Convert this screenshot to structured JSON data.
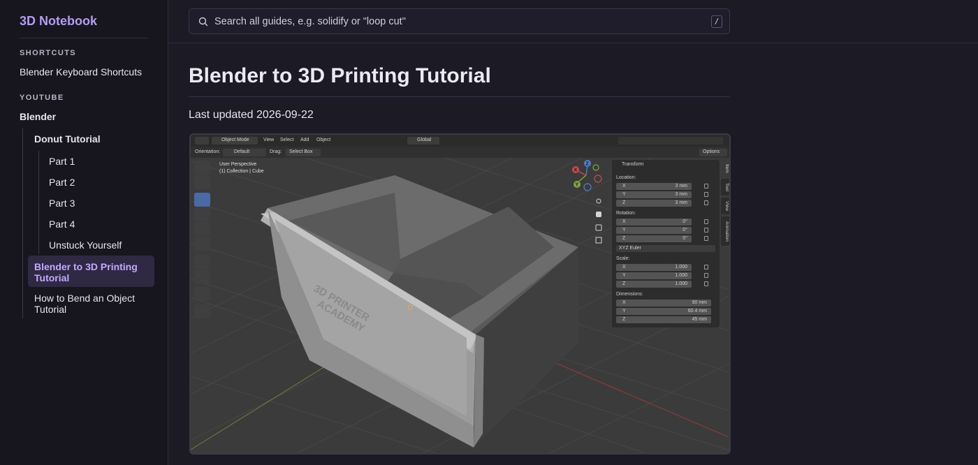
{
  "sidebar": {
    "brand": "3D Notebook",
    "sections": [
      {
        "heading": "SHORTCUTS",
        "items": [
          {
            "label": "Blender Keyboard Shortcuts"
          }
        ]
      },
      {
        "heading": "YOUTUBE"
      }
    ],
    "blender": {
      "label": "Blender",
      "donut": {
        "label": "Donut Tutorial",
        "parts": [
          "Part 1",
          "Part 2",
          "Part 3",
          "Part 4",
          "Unstuck Yourself"
        ]
      },
      "active": "Blender to 3D Printing Tutorial",
      "bend": "How to Bend an Object Tutorial"
    }
  },
  "search": {
    "placeholder": "Search all guides, e.g. solidify or \"loop cut\"",
    "shortcut": "/"
  },
  "article": {
    "title": "Blender to 3D Printing Tutorial",
    "updated": "Last updated 2026-09-22"
  },
  "screenshot": {
    "header": {
      "mode": "Object Mode",
      "menus": [
        "View",
        "Select",
        "Add",
        "Object"
      ],
      "orientation_global": "Global"
    },
    "tool_settings": {
      "orientation_label": "Orientation:",
      "orientation_value": "Default",
      "drag_label": "Drag:",
      "drag_value": "Select Box",
      "options": "Options"
    },
    "viewport": {
      "perspective": "User Perspective",
      "collection": "(1) Collection | Cube",
      "model_text": [
        "3D PRINTER",
        "ACADEMY"
      ],
      "gizmo_axes": [
        "X",
        "Y",
        "Z"
      ]
    },
    "transform_panel": {
      "title": "Transform",
      "location_label": "Location:",
      "location": [
        {
          "axis": "X",
          "value": "3 mm"
        },
        {
          "axis": "Y",
          "value": "3 mm"
        },
        {
          "axis": "Z",
          "value": "3 mm"
        }
      ],
      "rotation_label": "Rotation:",
      "rotation": [
        {
          "axis": "X",
          "value": "0°"
        },
        {
          "axis": "Y",
          "value": "0°"
        },
        {
          "axis": "Z",
          "value": "0°"
        }
      ],
      "rotation_mode": "XYZ Euler",
      "scale_label": "Scale:",
      "scale": [
        {
          "axis": "X",
          "value": "1.000"
        },
        {
          "axis": "Y",
          "value": "1.000"
        },
        {
          "axis": "Z",
          "value": "1.000"
        }
      ],
      "dimensions_label": "Dimensions:",
      "dimensions": [
        {
          "axis": "X",
          "value": "90 mm"
        },
        {
          "axis": "Y",
          "value": "60.4 mm"
        },
        {
          "axis": "Z",
          "value": "45 mm"
        }
      ]
    },
    "side_tabs": [
      "Item",
      "Tool",
      "View",
      "Animation"
    ]
  },
  "colors": {
    "accent": "#b49cf2",
    "active_bg": "#2f2943",
    "page_bg": "#1b1a25",
    "sidebar_bg": "#17161f"
  }
}
